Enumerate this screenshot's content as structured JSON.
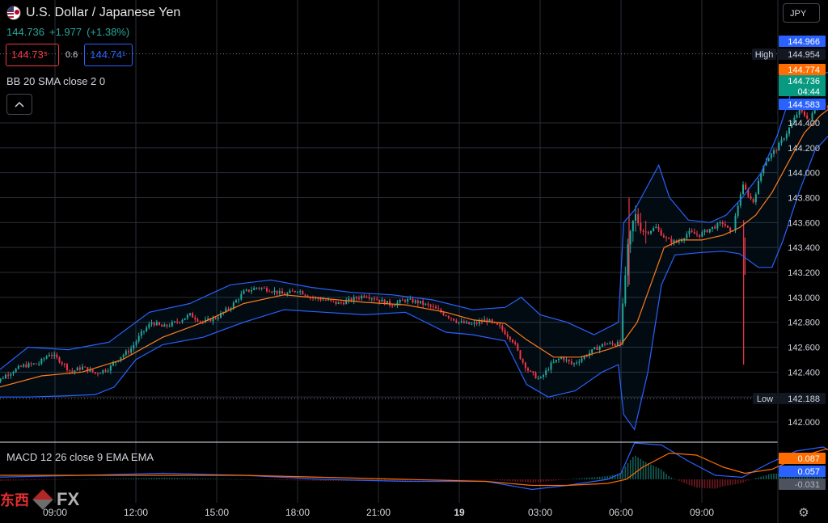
{
  "header": {
    "title": "U.S. Dollar / Japanese Yen",
    "last_price": "144.736",
    "change": "+1.977",
    "change_pct": "(+1.38%)",
    "sell_price": "144.73⁵",
    "spread": "0.6",
    "buy_price": "144.74¹",
    "currency_button": "JPY",
    "collapse_icon": "chevron-up-icon",
    "settings_icon": "gear-icon"
  },
  "indicators": {
    "bb_label": "BB 20 SMA close 2 0",
    "macd_label": "MACD 12 26 close 9 EMA EMA"
  },
  "logo": {
    "cn": "东西",
    "fx": "FX"
  },
  "colors": {
    "up": "#26a69a",
    "down": "#f23645",
    "bb_band": "#2962ff",
    "bb_basis": "#ff7b1a",
    "grid": "#2a2e39",
    "text": "#d1d4dc",
    "macd_line": "#2962ff",
    "signal_line": "#ff6d00"
  },
  "chart_data": [
    {
      "type": "candlestick",
      "symbol": "USDJPY",
      "ylim": [
        141.85,
        145.07
      ],
      "y_ticks": [
        142.0,
        142.2,
        142.4,
        142.6,
        142.8,
        143.0,
        143.2,
        143.4,
        143.6,
        143.8,
        144.0,
        144.2,
        144.4
      ],
      "y_tick_labels": [
        "142.000",
        "142.200",
        "142.400",
        "142.600",
        "142.800",
        "143.000",
        "143.200",
        "143.400",
        "143.600",
        "143.800",
        "144.000",
        "144.200",
        "144.400"
      ],
      "x_ticks": [
        "09:00",
        "12:00",
        "15:00",
        "18:00",
        "21:00",
        "19",
        "03:00",
        "06:00",
        "09:00"
      ],
      "x_tick_hours": [
        0,
        3,
        6,
        9,
        12,
        15,
        18,
        21,
        24
      ],
      "x_range_hours": [
        -2.4,
        26.8
      ],
      "price_labels": [
        {
          "label": "",
          "value": "144.966",
          "y": 144.966,
          "color": "#2962ff"
        },
        {
          "label": "High",
          "value": "144.954",
          "y": 144.954,
          "color": "#000000"
        },
        {
          "label": "",
          "value": "144.774",
          "y": 144.774,
          "color": "#ff6d00"
        },
        {
          "label": "",
          "value": "144.736",
          "sub": "04:44",
          "y": 144.736,
          "color": "#089981"
        },
        {
          "label": "",
          "value": "144.583",
          "y": 144.583,
          "color": "#2962ff"
        },
        {
          "label": "Low",
          "value": "142.188",
          "y": 142.188,
          "color": "#000000"
        }
      ],
      "close_path": [
        [
          -2.4,
          142.28
        ],
        [
          -1.8,
          142.38
        ],
        [
          -1.2,
          142.45
        ],
        [
          -0.6,
          142.47
        ],
        [
          -0.2,
          142.55
        ],
        [
          0.2,
          142.49
        ],
        [
          0.6,
          142.4
        ],
        [
          1.0,
          142.44
        ],
        [
          1.5,
          142.39
        ],
        [
          2.0,
          142.43
        ],
        [
          2.4,
          142.52
        ],
        [
          2.8,
          142.58
        ],
        [
          3.2,
          142.71
        ],
        [
          3.6,
          142.8
        ],
        [
          4.0,
          142.76
        ],
        [
          4.5,
          142.8
        ],
        [
          5.0,
          142.86
        ],
        [
          5.5,
          142.8
        ],
        [
          6.0,
          142.84
        ],
        [
          6.5,
          142.92
        ],
        [
          7.0,
          143.04
        ],
        [
          7.5,
          143.08
        ],
        [
          8.0,
          143.06
        ],
        [
          8.5,
          143.02
        ],
        [
          9.0,
          143.06
        ],
        [
          9.5,
          143.0
        ],
        [
          10.0,
          142.98
        ],
        [
          10.5,
          142.95
        ],
        [
          11.0,
          142.98
        ],
        [
          11.5,
          143.02
        ],
        [
          12.0,
          142.98
        ],
        [
          12.5,
          142.94
        ],
        [
          13.0,
          142.98
        ],
        [
          13.5,
          142.96
        ],
        [
          14.0,
          142.92
        ],
        [
          14.5,
          142.86
        ],
        [
          15.0,
          142.8
        ],
        [
          15.5,
          142.78
        ],
        [
          16.0,
          142.82
        ],
        [
          16.5,
          142.76
        ],
        [
          17.0,
          142.65
        ],
        [
          17.3,
          142.5
        ],
        [
          17.6,
          142.4
        ],
        [
          18.0,
          142.34
        ],
        [
          18.4,
          142.46
        ],
        [
          18.8,
          142.52
        ],
        [
          19.2,
          142.46
        ],
        [
          19.6,
          142.52
        ],
        [
          20.0,
          142.58
        ],
        [
          20.4,
          142.63
        ],
        [
          20.8,
          142.62
        ],
        [
          21.0,
          142.7
        ],
        [
          21.2,
          143.3
        ],
        [
          21.5,
          143.66
        ],
        [
          21.9,
          143.52
        ],
        [
          22.3,
          143.56
        ],
        [
          22.7,
          143.46
        ],
        [
          23.1,
          143.44
        ],
        [
          23.5,
          143.52
        ],
        [
          23.9,
          143.5
        ],
        [
          24.3,
          143.55
        ],
        [
          24.8,
          143.6
        ],
        [
          25.1,
          143.5
        ],
        [
          25.5,
          143.9
        ],
        [
          25.9,
          143.76
        ],
        [
          26.3,
          144.08
        ],
        [
          26.8,
          144.2
        ],
        [
          27.2,
          144.34
        ],
        [
          27.6,
          144.5
        ],
        [
          28.0,
          144.43
        ],
        [
          28.4,
          144.58
        ],
        [
          28.8,
          144.5
        ],
        [
          29.2,
          144.62
        ],
        [
          29.6,
          144.82
        ],
        [
          30.0,
          144.88
        ],
        [
          30.4,
          144.74
        ]
      ],
      "wicks": [
        {
          "x": 25.55,
          "high": 143.62,
          "low": 142.46
        },
        {
          "x": 25.6,
          "high": 143.48,
          "low": 143.18
        },
        {
          "x": 21.3,
          "high": 143.8,
          "low": 143.1
        }
      ],
      "bb_upper": [
        [
          -2.4,
          142.36
        ],
        [
          -1.0,
          142.6
        ],
        [
          0.5,
          142.58
        ],
        [
          2.0,
          142.64
        ],
        [
          3.5,
          142.88
        ],
        [
          5.0,
          142.95
        ],
        [
          6.5,
          143.1
        ],
        [
          8.0,
          143.14
        ],
        [
          9.5,
          143.08
        ],
        [
          11.0,
          143.04
        ],
        [
          12.5,
          143.02
        ],
        [
          14.0,
          142.98
        ],
        [
          15.5,
          142.9
        ],
        [
          16.7,
          142.92
        ],
        [
          17.3,
          143.0
        ],
        [
          18.0,
          142.86
        ],
        [
          19.0,
          142.8
        ],
        [
          20.0,
          142.7
        ],
        [
          20.9,
          142.8
        ],
        [
          21.1,
          143.6
        ],
        [
          21.5,
          143.7
        ],
        [
          22.0,
          143.9
        ],
        [
          22.4,
          144.06
        ],
        [
          22.8,
          143.8
        ],
        [
          23.5,
          143.62
        ],
        [
          24.3,
          143.6
        ],
        [
          24.9,
          143.66
        ],
        [
          25.5,
          143.8
        ],
        [
          26.2,
          144.0
        ],
        [
          26.8,
          144.3
        ],
        [
          27.4,
          144.7
        ],
        [
          28.0,
          144.82
        ],
        [
          28.6,
          144.8
        ],
        [
          29.3,
          144.86
        ],
        [
          29.9,
          144.97
        ],
        [
          30.4,
          144.95
        ]
      ],
      "bb_lower": [
        [
          -2.4,
          142.2
        ],
        [
          -1.0,
          142.2
        ],
        [
          0.5,
          142.21
        ],
        [
          1.5,
          142.22
        ],
        [
          2.2,
          142.28
        ],
        [
          3.0,
          142.5
        ],
        [
          4.0,
          142.62
        ],
        [
          5.5,
          142.68
        ],
        [
          7.0,
          142.8
        ],
        [
          8.5,
          142.9
        ],
        [
          10.0,
          142.88
        ],
        [
          11.5,
          142.86
        ],
        [
          13.0,
          142.88
        ],
        [
          14.5,
          142.72
        ],
        [
          15.5,
          142.7
        ],
        [
          16.7,
          142.65
        ],
        [
          17.5,
          142.3
        ],
        [
          18.3,
          142.2
        ],
        [
          19.3,
          142.25
        ],
        [
          20.3,
          142.4
        ],
        [
          20.9,
          142.46
        ],
        [
          21.1,
          142.06
        ],
        [
          21.5,
          141.94
        ],
        [
          22.0,
          142.4
        ],
        [
          22.5,
          143.1
        ],
        [
          23.0,
          143.34
        ],
        [
          24.0,
          143.36
        ],
        [
          24.8,
          143.37
        ],
        [
          25.4,
          143.35
        ],
        [
          26.1,
          143.24
        ],
        [
          26.6,
          143.24
        ],
        [
          27.0,
          143.45
        ],
        [
          27.6,
          143.84
        ],
        [
          28.2,
          144.18
        ],
        [
          28.8,
          144.32
        ],
        [
          29.4,
          144.4
        ],
        [
          30.0,
          144.5
        ],
        [
          30.4,
          144.6
        ]
      ],
      "bb_basis": [
        [
          -2.4,
          142.26
        ],
        [
          -0.5,
          142.37
        ],
        [
          1.0,
          142.4
        ],
        [
          2.5,
          142.5
        ],
        [
          4.0,
          142.68
        ],
        [
          5.5,
          142.8
        ],
        [
          7.0,
          142.95
        ],
        [
          8.5,
          143.02
        ],
        [
          10.0,
          142.99
        ],
        [
          11.5,
          142.96
        ],
        [
          13.0,
          142.94
        ],
        [
          14.5,
          142.88
        ],
        [
          15.5,
          142.82
        ],
        [
          16.7,
          142.79
        ],
        [
          17.5,
          142.66
        ],
        [
          18.5,
          142.52
        ],
        [
          19.5,
          142.52
        ],
        [
          20.5,
          142.58
        ],
        [
          21.0,
          142.62
        ],
        [
          21.6,
          142.8
        ],
        [
          22.2,
          143.16
        ],
        [
          22.6,
          143.4
        ],
        [
          23.2,
          143.46
        ],
        [
          24.0,
          143.46
        ],
        [
          24.8,
          143.5
        ],
        [
          25.4,
          143.56
        ],
        [
          26.0,
          143.66
        ],
        [
          26.6,
          143.84
        ],
        [
          27.2,
          144.08
        ],
        [
          27.8,
          144.32
        ],
        [
          28.4,
          144.46
        ],
        [
          29.0,
          144.56
        ],
        [
          29.6,
          144.66
        ],
        [
          30.4,
          144.77
        ]
      ]
    },
    {
      "type": "macd",
      "price_labels": [
        {
          "value": "0.087",
          "color": "#ff6d00"
        },
        {
          "value": "0.057",
          "color": "#2962ff"
        },
        {
          "value": "-0.031",
          "color": "#4c525e"
        }
      ],
      "ylim": [
        -0.1,
        0.22
      ],
      "macd_line": [
        [
          -2.4,
          0.01
        ],
        [
          1.0,
          0.02
        ],
        [
          4.0,
          0.03
        ],
        [
          7.0,
          0.02
        ],
        [
          10.0,
          0.0
        ],
        [
          13.0,
          -0.01
        ],
        [
          16.0,
          -0.01
        ],
        [
          17.7,
          -0.05
        ],
        [
          19.0,
          -0.03
        ],
        [
          20.5,
          0.0
        ],
        [
          21.0,
          0.03
        ],
        [
          21.5,
          0.18
        ],
        [
          22.5,
          0.17
        ],
        [
          23.5,
          0.09
        ],
        [
          24.5,
          0.02
        ],
        [
          25.5,
          0.01
        ],
        [
          26.5,
          0.08
        ],
        [
          27.5,
          0.14
        ],
        [
          28.5,
          0.16
        ],
        [
          29.5,
          0.09
        ],
        [
          30.4,
          0.06
        ]
      ],
      "signal_line": [
        [
          -2.4,
          0.02
        ],
        [
          1.0,
          0.02
        ],
        [
          4.0,
          0.02
        ],
        [
          7.0,
          0.02
        ],
        [
          10.0,
          0.01
        ],
        [
          13.0,
          0.0
        ],
        [
          16.0,
          -0.01
        ],
        [
          17.7,
          -0.03
        ],
        [
          19.0,
          -0.03
        ],
        [
          20.5,
          -0.02
        ],
        [
          21.2,
          0.0
        ],
        [
          21.8,
          0.06
        ],
        [
          22.8,
          0.13
        ],
        [
          23.8,
          0.12
        ],
        [
          24.8,
          0.06
        ],
        [
          25.6,
          0.03
        ],
        [
          26.6,
          0.05
        ],
        [
          27.6,
          0.11
        ],
        [
          28.6,
          0.15
        ],
        [
          29.6,
          0.11
        ],
        [
          30.4,
          0.09
        ]
      ]
    }
  ]
}
